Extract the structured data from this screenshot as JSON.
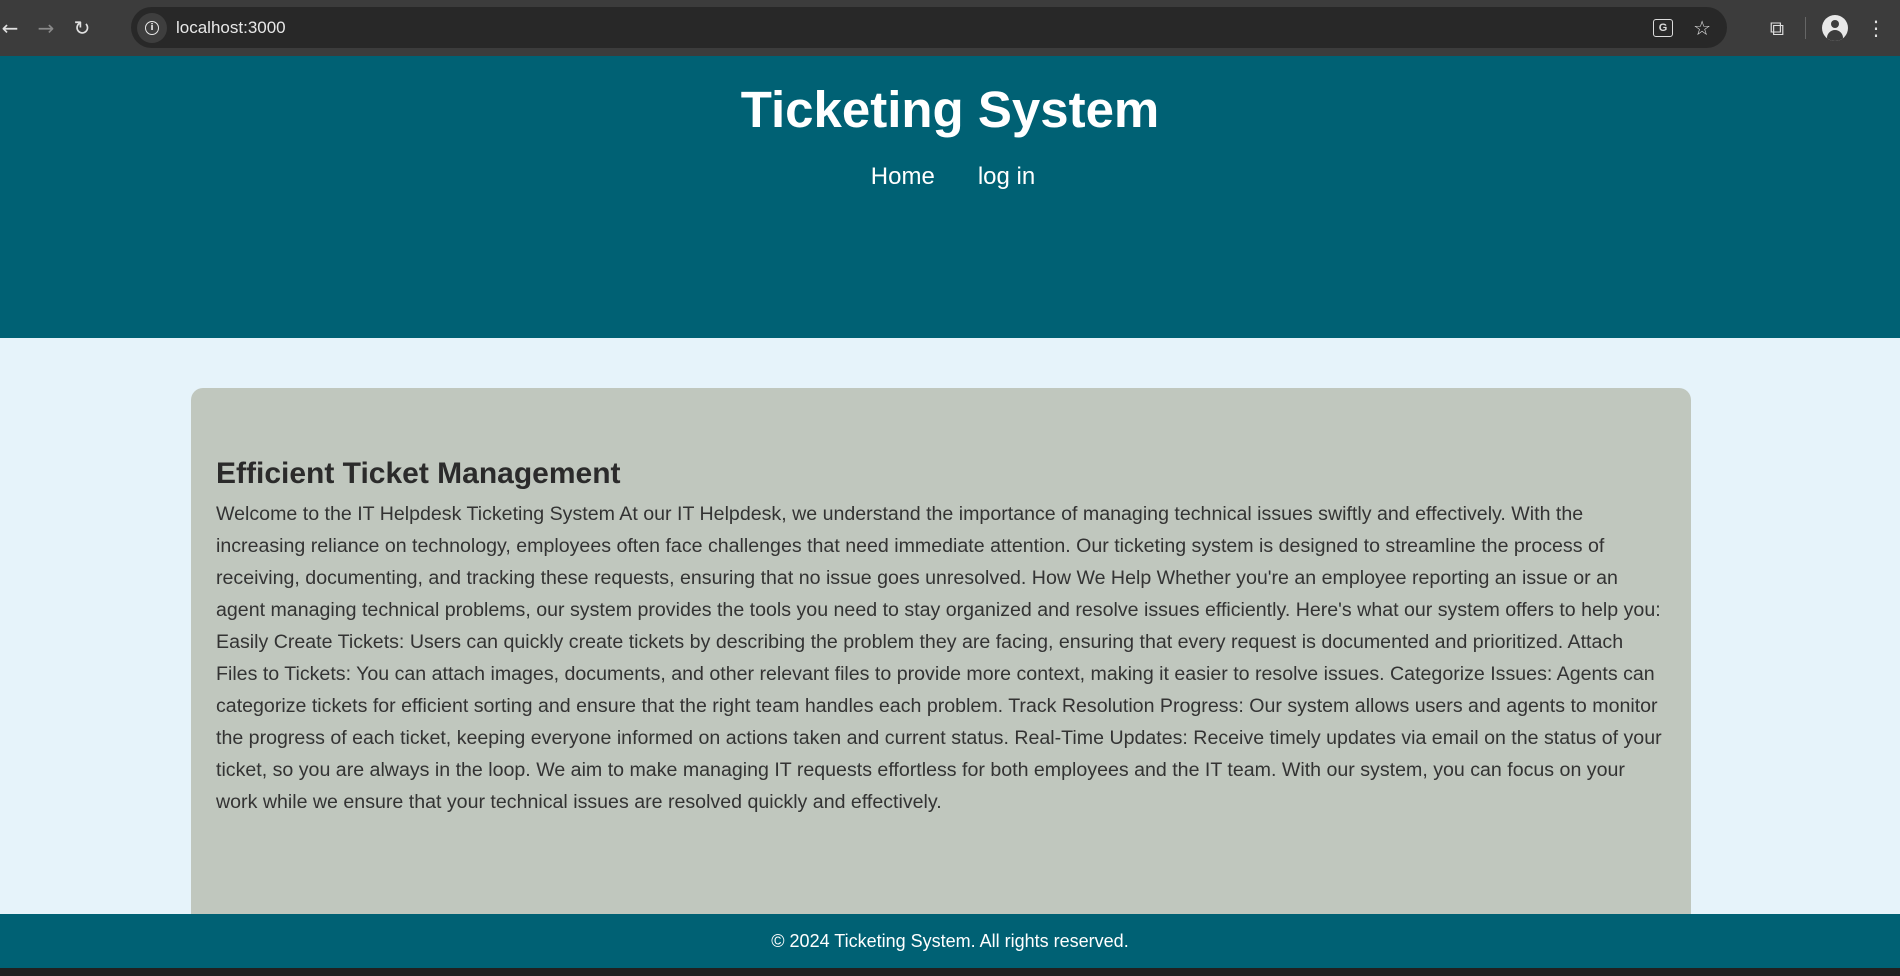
{
  "browser": {
    "url": "localhost:3000",
    "icons": [
      "back-icon",
      "forward-icon",
      "reload-icon",
      "site-info-icon",
      "translate-icon",
      "bookmark-star-icon",
      "extensions-icon",
      "profile-icon",
      "menu-icon"
    ]
  },
  "header": {
    "title": "Ticketing System",
    "nav": [
      {
        "label": "Home"
      },
      {
        "label": "log in"
      }
    ]
  },
  "main": {
    "heading": "Efficient Ticket Management",
    "body": "Welcome to the IT Helpdesk Ticketing System At our IT Helpdesk, we understand the importance of managing technical issues swiftly and effectively. With the increasing reliance on technology, employees often face challenges that need immediate attention. Our ticketing system is designed to streamline the process of receiving, documenting, and tracking these requests, ensuring that no issue goes unresolved. How We Help Whether you're an employee reporting an issue or an agent managing technical problems, our system provides the tools you need to stay organized and resolve issues efficiently. Here's what our system offers to help you: Easily Create Tickets: Users can quickly create tickets by describing the problem they are facing, ensuring that every request is documented and prioritized. Attach Files to Tickets: You can attach images, documents, and other relevant files to provide more context, making it easier to resolve issues. Categorize Issues: Agents can categorize tickets for efficient sorting and ensure that the right team handles each problem. Track Resolution Progress: Our system allows users and agents to monitor the progress of each ticket, keeping everyone informed on actions taken and current status. Real-Time Updates: Receive timely updates via email on the status of your ticket, so you are always in the loop. We aim to make managing IT requests effortless for both employees and the IT team. With our system, you can focus on your work while we ensure that your technical issues are resolved quickly and effectively."
  },
  "footer": {
    "text": "© 2024 Ticketing System. All rights reserved."
  },
  "colors": {
    "header_bg": "#006174",
    "page_bg": "#e6f3fa",
    "card_bg": "#c0c7be"
  }
}
